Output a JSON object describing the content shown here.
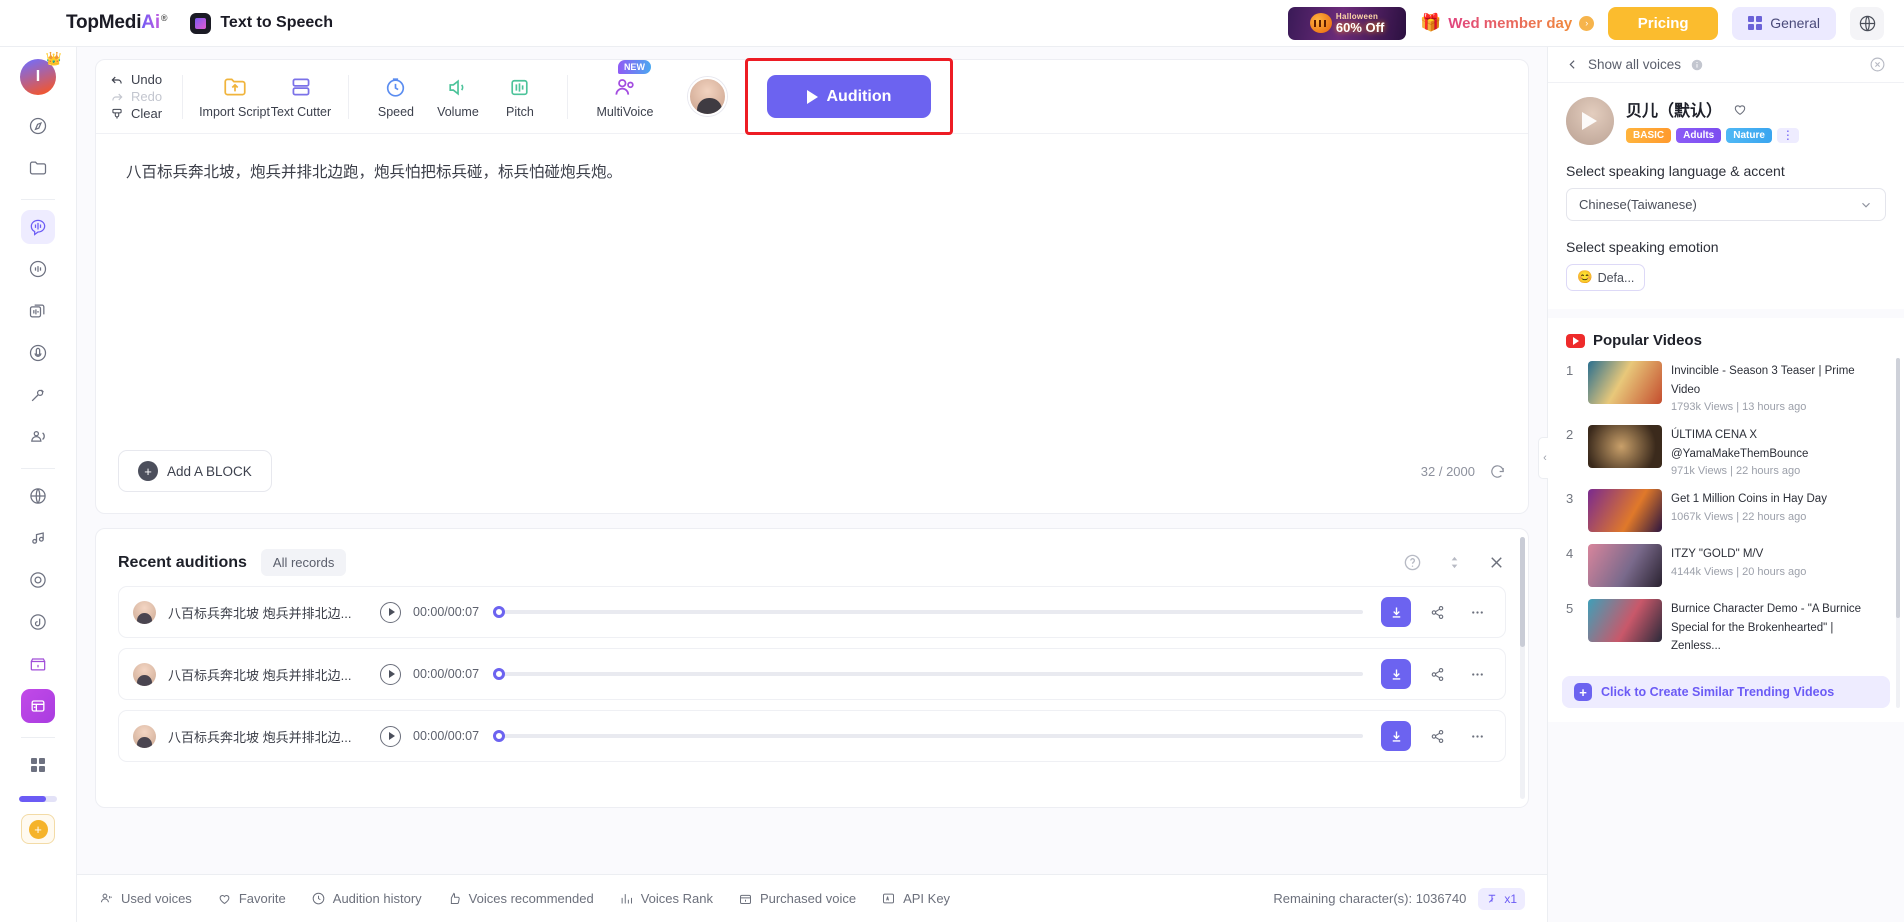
{
  "header": {
    "brand_top": "TopMedi",
    "brand_ai": "Ai",
    "brand_reg": "®",
    "app_title": "Text to Speech",
    "promo": {
      "line1": "Halloween",
      "line2": "60% Off"
    },
    "member_day": "Wed member day",
    "pricing_label": "Pricing",
    "general_label": "General",
    "globe_icon": "globe-icon"
  },
  "sidebar": {
    "avatar_initial": "I",
    "crown_icon": "crown-icon",
    "items": [
      {
        "name": "discover-icon"
      },
      {
        "name": "folder-icon"
      },
      {
        "name": "text-to-speech-icon",
        "active": true
      },
      {
        "name": "voice-changer-icon"
      },
      {
        "name": "multi-track-icon"
      },
      {
        "name": "voice-clone-icon"
      },
      {
        "name": "voice-recorder-icon"
      },
      {
        "name": "speech-to-text-icon"
      },
      {
        "name": "translator-icon"
      },
      {
        "name": "music-icon"
      },
      {
        "name": "vinyl-icon"
      },
      {
        "name": "tiktok-icon"
      },
      {
        "name": "store-icon"
      },
      {
        "name": "ai-tools-icon"
      },
      {
        "name": "apps-grid-icon"
      }
    ],
    "plus_label": "+"
  },
  "toolbar": {
    "undo": "Undo",
    "redo": "Redo",
    "clear": "Clear",
    "import_script": "Import Script",
    "text_cutter": "Text Cutter",
    "speed": "Speed",
    "volume": "Volume",
    "pitch": "Pitch",
    "multivoice": "MultiVoice",
    "new_badge": "NEW",
    "audition": "Audition"
  },
  "editor": {
    "text": "八百标兵奔北坡，炮兵并排北边跑，炮兵怕把标兵碰，标兵怕碰炮兵炮。",
    "add_block": "Add A BLOCK",
    "counter": "32 / 2000",
    "refresh_icon": "refresh-icon"
  },
  "recent": {
    "title": "Recent auditions",
    "all_records": "All records",
    "help_icon": "help-icon",
    "sort_icon": "sort-icon",
    "close_icon": "close-icon",
    "rows": [
      {
        "title": "八百标兵奔北坡 炮兵并排北边...",
        "time": "00:00/00:07"
      },
      {
        "title": "八百标兵奔北坡 炮兵并排北边...",
        "time": "00:00/00:07"
      },
      {
        "title": "八百标兵奔北坡 炮兵并排北边...",
        "time": "00:00/00:07"
      }
    ],
    "download_icon": "download-icon",
    "share_icon": "share-icon",
    "more_icon": "more-icon"
  },
  "footer": {
    "items": [
      {
        "label": "Used voices",
        "icon": "used-voices-icon"
      },
      {
        "label": "Favorite",
        "icon": "heart-icon"
      },
      {
        "label": "Audition history",
        "icon": "clock-icon"
      },
      {
        "label": "Voices recommended",
        "icon": "thumbs-up-icon"
      },
      {
        "label": "Voices Rank",
        "icon": "bar-chart-icon"
      },
      {
        "label": "Purchased voice",
        "icon": "purchased-icon"
      },
      {
        "label": "API Key",
        "icon": "api-key-icon"
      }
    ],
    "remaining": "Remaining character(s): 1036740",
    "speed_chip": "x1"
  },
  "right_panel": {
    "show_all_voices": "Show all voices",
    "back_icon": "chevron-left-icon",
    "info_icon": "info-icon",
    "close_icon": "close-circle-icon",
    "voice": {
      "name": "贝儿（默认）",
      "favorite_icon": "heart-icon",
      "tags": [
        "BASIC",
        "Adults",
        "Nature"
      ],
      "more_icon": "more-vertical-icon"
    },
    "language_label": "Select speaking language & accent",
    "language_value": "Chinese(Taiwanese)",
    "emotion_label": "Select speaking emotion",
    "emotion_value": "Defa...",
    "emotion_emoji": "😊",
    "popular_videos_title": "Popular Videos",
    "videos": [
      {
        "rank": "1",
        "title": "Invincible - Season 3 Teaser | Prime Video",
        "meta": "1793k Views | 13 hours ago"
      },
      {
        "rank": "2",
        "title": "ÚLTIMA CENA X @YamaMakeThemBounce",
        "meta": "971k Views | 22 hours ago"
      },
      {
        "rank": "3",
        "title": "Get 1 Million Coins in Hay Day",
        "meta": "1067k Views | 22 hours ago"
      },
      {
        "rank": "4",
        "title": "ITZY \"GOLD\" M/V",
        "meta": "4144k Views | 20 hours ago"
      },
      {
        "rank": "5",
        "title": "Burnice Character Demo - \"A Burnice Special for the Brokenhearted\" | Zenless...",
        "meta": ""
      }
    ],
    "cta": "Click to Create Similar Trending Videos"
  },
  "colors": {
    "accent": "#6c63f0",
    "highlight_border": "#ed1c24",
    "pricing": "#fbbc2e"
  }
}
